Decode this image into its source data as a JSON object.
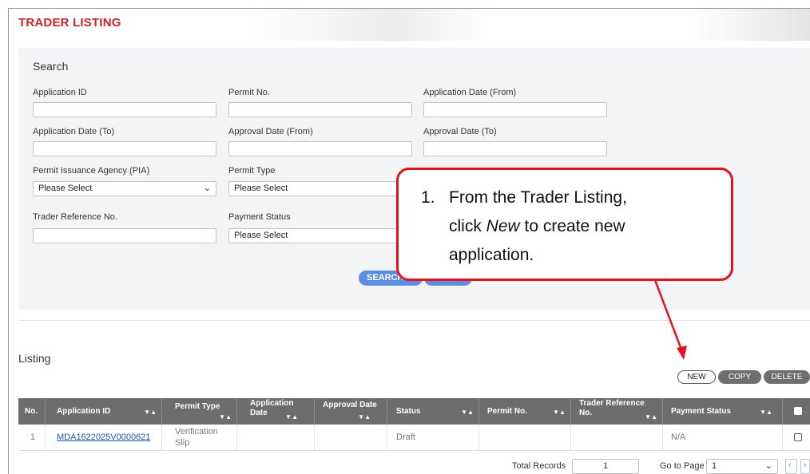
{
  "page": {
    "title": "TRADER LISTING"
  },
  "search": {
    "heading": "Search",
    "labels": {
      "application_id": "Application ID",
      "permit_no": "Permit No.",
      "application_date_from": "Application Date (From)",
      "application_date_to": "Application Date (To)",
      "approval_date_from": "Approval Date (From)",
      "approval_date_to": "Approval Date (To)",
      "pia": "Permit Issuance Agency (PIA)",
      "permit_type": "Permit Type",
      "trader_reference_no": "Trader Reference No.",
      "payment_status": "Payment Status"
    },
    "select_placeholder": "Please Select",
    "search_button": "SEARCH"
  },
  "callout": {
    "number": "1.",
    "lines": [
      "From the Trader Listing,",
      "click ",
      "New",
      " to create new",
      "application."
    ]
  },
  "listing": {
    "heading": "Listing",
    "actions": {
      "new": "NEW",
      "copy": "COPY",
      "delete": "DELETE"
    },
    "columns": {
      "no": "No.",
      "application_id": "Application ID",
      "permit_type": "Permit Type",
      "application_date_1": "Application",
      "application_date_2": "Date",
      "approval_date": "Approval Date",
      "status": "Status",
      "permit_no": "Permit No.",
      "trader_reference_1": "Trader Reference",
      "trader_reference_2": "No.",
      "payment_status": "Payment Status"
    },
    "rows": [
      {
        "no": "1",
        "application_id": "MDA1622025V0000621",
        "permit_type_1": "Verification",
        "permit_type_2": "Slip",
        "application_date": "",
        "approval_date": "",
        "status": "Draft",
        "permit_no": "",
        "trader_reference_no": "",
        "payment_status": "N/A"
      }
    ],
    "footer": {
      "total_records_label": "Total Records",
      "total_records": "1",
      "go_to_page_label": "Go to Page",
      "page": "1"
    }
  },
  "colors": {
    "title_red": "#c8222b",
    "callout_border": "#e0141e",
    "header_grey": "#6d6d6d",
    "button_blue": "#5b8ee0",
    "link_blue": "#1a56a8"
  },
  "icons": {
    "sort": "sort-arrows-icon",
    "dropdown": "chevron-down-icon",
    "pager_prev": "chevron-left-icon",
    "pager_next": "chevron-right-icon"
  }
}
